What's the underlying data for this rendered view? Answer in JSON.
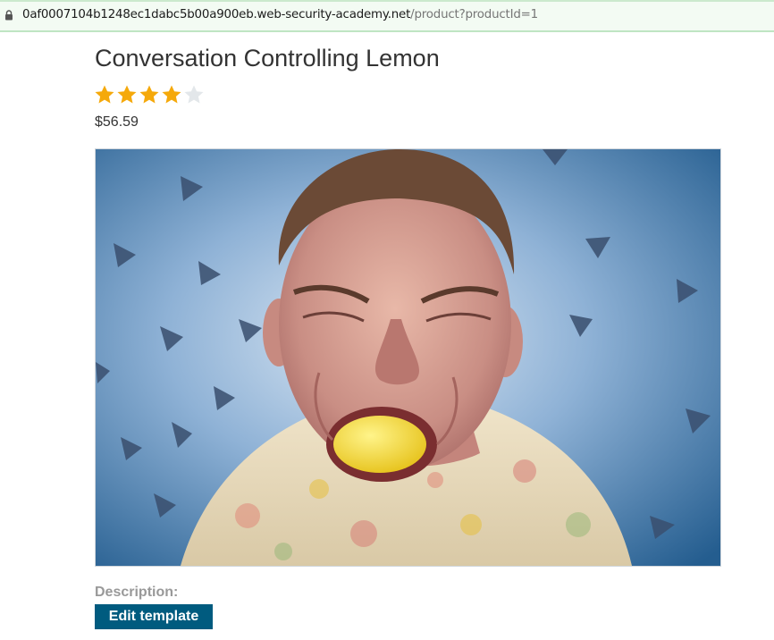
{
  "browser": {
    "url_host": "0af0007104b1248ec1dabc5b00a900eb.web-security-academy.net",
    "url_path": "/product?productId=1"
  },
  "product": {
    "title": "Conversation Controlling Lemon",
    "rating": {
      "value": 4,
      "max": 5
    },
    "price": "$56.59",
    "description_label": "Description:",
    "edit_button_label": "Edit template"
  },
  "colors": {
    "star_filled": "#f5a90b",
    "star_empty": "#e3e7ea",
    "button_bg": "#005b7f",
    "address_bar_bg": "#f3fbf3"
  },
  "icons": {
    "address_bar": "lock-icon",
    "rating": "star-icon"
  }
}
